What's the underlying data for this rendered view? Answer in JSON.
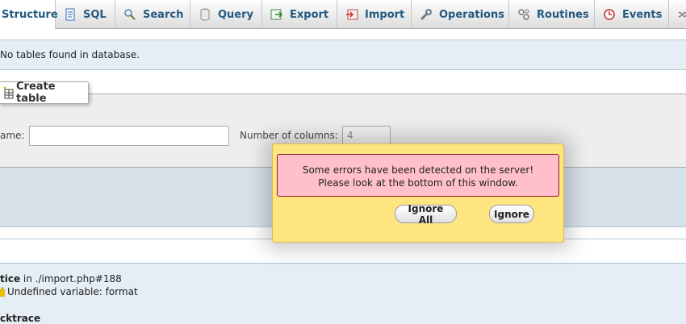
{
  "tabs": [
    {
      "label": "Structure",
      "icon": "structure-icon",
      "active": true
    },
    {
      "label": "SQL",
      "icon": "sql-icon"
    },
    {
      "label": "Search",
      "icon": "search-icon"
    },
    {
      "label": "Query",
      "icon": "query-icon"
    },
    {
      "label": "Export",
      "icon": "export-icon"
    },
    {
      "label": "Import",
      "icon": "import-icon"
    },
    {
      "label": "Operations",
      "icon": "wrench-icon"
    },
    {
      "label": "Routines",
      "icon": "routines-icon"
    },
    {
      "label": "Events",
      "icon": "clock-icon"
    }
  ],
  "notice": {
    "text": "No tables found in database."
  },
  "create_table": {
    "legend": "Create table",
    "name_label": "ame:",
    "name_value": "",
    "columns_label": "Number of columns:",
    "columns_value": "4"
  },
  "errors": {
    "line1_prefix": "tice",
    "line1_rest": " in ./import.php#188",
    "line2": "Undefined variable: format",
    "line3": "cktrace"
  },
  "dialog": {
    "message_line1": "Some errors have been detected on the server!",
    "message_line2": "Please look at the bottom of this window.",
    "ignore_all_label": "Ignore All",
    "ignore_label": "Ignore"
  },
  "colors": {
    "tab_text": "#235a81",
    "dialog_bg": "#ffe57f",
    "dialog_msg_bg": "#ffc0cb",
    "notice_bg": "#e5eef5"
  }
}
